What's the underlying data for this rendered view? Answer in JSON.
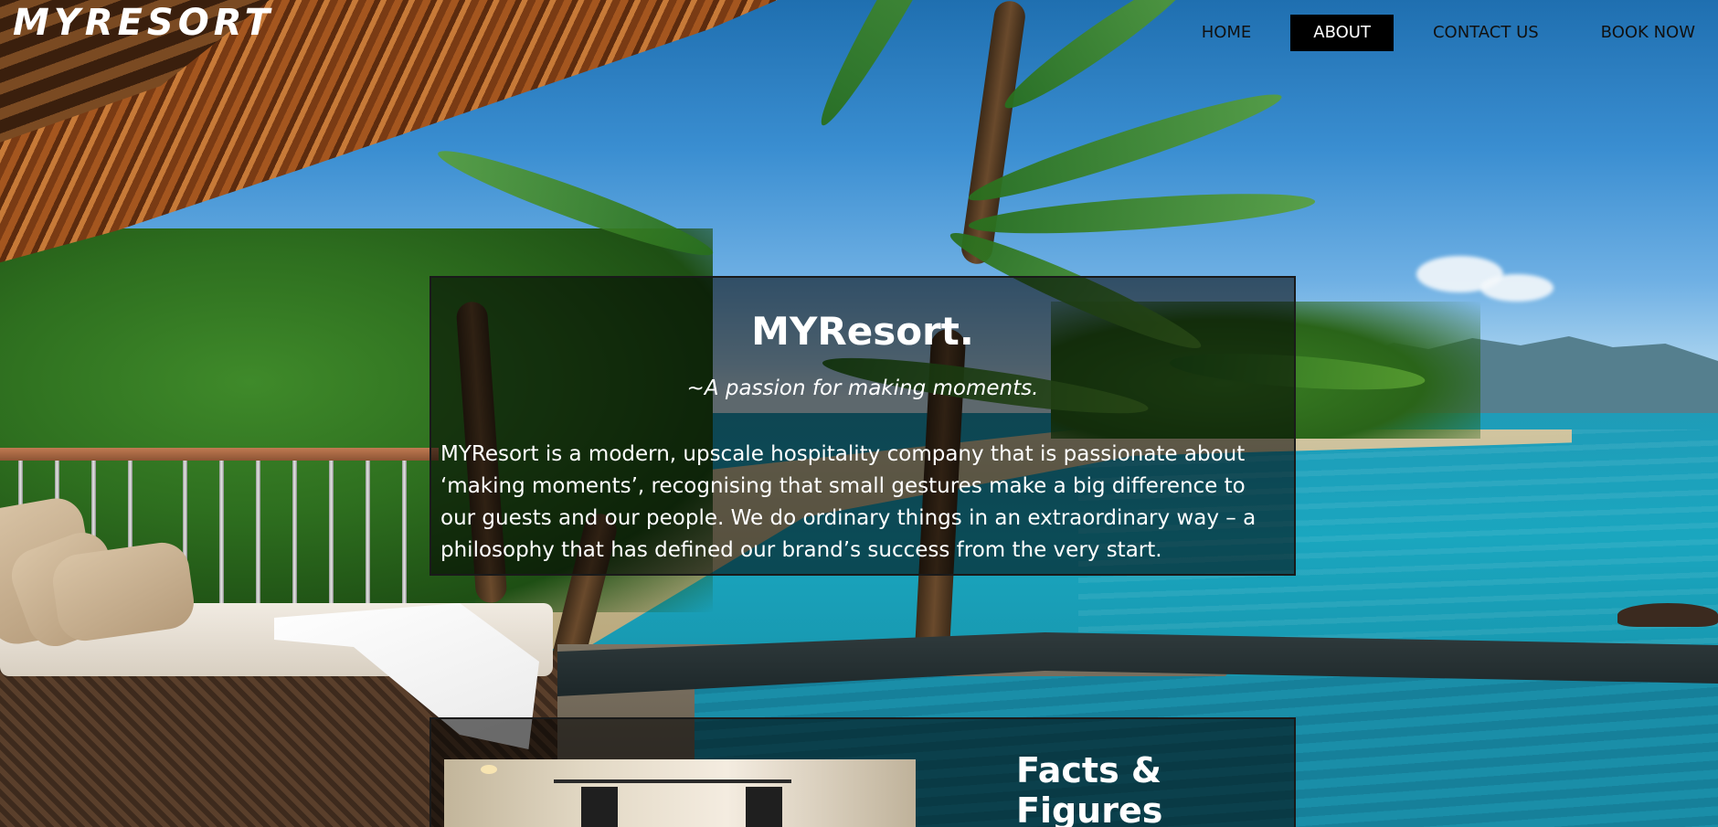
{
  "header": {
    "logo": "MYRESORT",
    "nav": [
      {
        "label": "HOME",
        "active": false
      },
      {
        "label": "ABOUT",
        "active": true
      },
      {
        "label": "CONTACT US",
        "active": false
      },
      {
        "label": "BOOK NOW",
        "active": false
      }
    ]
  },
  "about": {
    "title": "MYResort.",
    "tagline": "~A passion for making moments.",
    "body": "MYResort is a modern, upscale hospitality company that is passionate about ‘making moments’, recognising that small gestures make a big difference to our guests and our people. We do ordinary things in an extraordinary way – a philosophy that has defined our brand’s success from the very start."
  },
  "facts": {
    "title": "Facts & Figures"
  },
  "colors": {
    "nav_active_bg": "#000000",
    "nav_text": "#111111",
    "panel_bg": "rgba(0,0,0,0.55)",
    "logo": "#ffffff"
  }
}
